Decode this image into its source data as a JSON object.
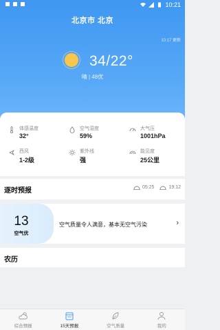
{
  "status_bar": {
    "time": "10:21"
  },
  "header": {
    "city": "北京市 北京",
    "updated": "10:17 更新"
  },
  "current": {
    "temp": "34/22°",
    "condition": "晴 | 48优"
  },
  "details": [
    {
      "icon": "thermometer-icon",
      "label": "体感温度",
      "value": "32°"
    },
    {
      "icon": "droplet-icon",
      "label": "空气湿度",
      "value": "59%"
    },
    {
      "icon": "gauge-icon",
      "label": "大气压",
      "value": "1001hPa"
    },
    {
      "icon": "wind-icon",
      "label": "西风",
      "value": "1-2级"
    },
    {
      "icon": "sun-small-icon",
      "label": "紫外线",
      "value": "强"
    },
    {
      "icon": "visibility-icon",
      "label": "能见度",
      "value": "25公里"
    }
  ],
  "hourly": {
    "title": "逐时预报",
    "sunrise": "05:25",
    "sunset": "19:12"
  },
  "aqi": {
    "value": "13",
    "level": "空气优",
    "description": "空气质量令人满意，基本无空气污染"
  },
  "calendar": {
    "title": "农历"
  },
  "tabs": [
    {
      "label": "综合预报",
      "icon": "cloud-sun-icon",
      "active": false
    },
    {
      "label": "15天预报",
      "icon": "calendar-icon",
      "active": true
    },
    {
      "label": "空气质量",
      "icon": "leaf-icon",
      "active": false
    },
    {
      "label": "我的",
      "icon": "user-icon",
      "active": false
    }
  ],
  "colors": {
    "hero_top": "#3f97f2",
    "hero_bottom": "#6cb4f8",
    "sun": "#f8c64a"
  }
}
